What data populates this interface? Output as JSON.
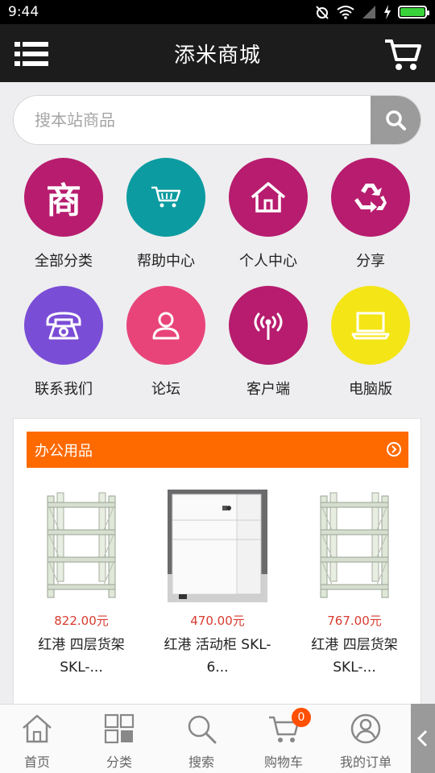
{
  "status_bar": {
    "time": "9:44",
    "icons": [
      "alarm-off-icon",
      "wifi-icon",
      "signal-icon",
      "charging-icon",
      "battery-icon"
    ],
    "battery_level": 1.0
  },
  "header": {
    "title": "添米商城",
    "menu_icon": "hamburger-menu-icon",
    "cart_icon": "shopping-cart-icon"
  },
  "search": {
    "placeholder": "搜本站商品",
    "button_icon": "search-icon"
  },
  "shortcuts": [
    {
      "label": "全部分类",
      "icon": "shop-character-icon",
      "glyph": "商",
      "color": "#b71c6e"
    },
    {
      "label": "帮助中心",
      "icon": "cart-icon",
      "color": "#0c9ba0"
    },
    {
      "label": "个人中心",
      "icon": "home-icon",
      "color": "#b71c6e"
    },
    {
      "label": "分享",
      "icon": "recycle-icon",
      "color": "#b71c6e"
    },
    {
      "label": "联系我们",
      "icon": "telephone-icon",
      "color": "#7a4dd6"
    },
    {
      "label": "论坛",
      "icon": "user-icon",
      "color": "#e8447a"
    },
    {
      "label": "客户端",
      "icon": "antenna-icon",
      "color": "#b71c6e"
    },
    {
      "label": "电脑版",
      "icon": "laptop-icon",
      "color": "#f4e516"
    }
  ],
  "section": {
    "title": "办公用品",
    "more_icon": "arrow-circle-right-icon"
  },
  "products": [
    {
      "price": "822.00元",
      "name_line1": "红港 四层货架",
      "name_line2": "SKL-...",
      "image": "shelf"
    },
    {
      "price": "470.00元",
      "name_line1": "红港 活动柜 SKL-",
      "name_line2": "6...",
      "image": "cabinet"
    },
    {
      "price": "767.00元",
      "name_line1": "红港 四层货架",
      "name_line2": "SKL-...",
      "image": "shelf"
    }
  ],
  "tabs": [
    {
      "label": "首页",
      "icon": "home-icon"
    },
    {
      "label": "分类",
      "icon": "category-grid-icon"
    },
    {
      "label": "搜索",
      "icon": "search-icon"
    },
    {
      "label": "购物车",
      "icon": "shopping-cart-icon",
      "badge": "0"
    },
    {
      "label": "我的订单",
      "icon": "user-circle-icon"
    }
  ],
  "side_toggle_icon": "chevron-left-icon",
  "colors": {
    "header_bg": "#1c1c1c",
    "section_bar": "#ff6a00",
    "price": "#d93b30",
    "badge": "#ff4f00"
  }
}
